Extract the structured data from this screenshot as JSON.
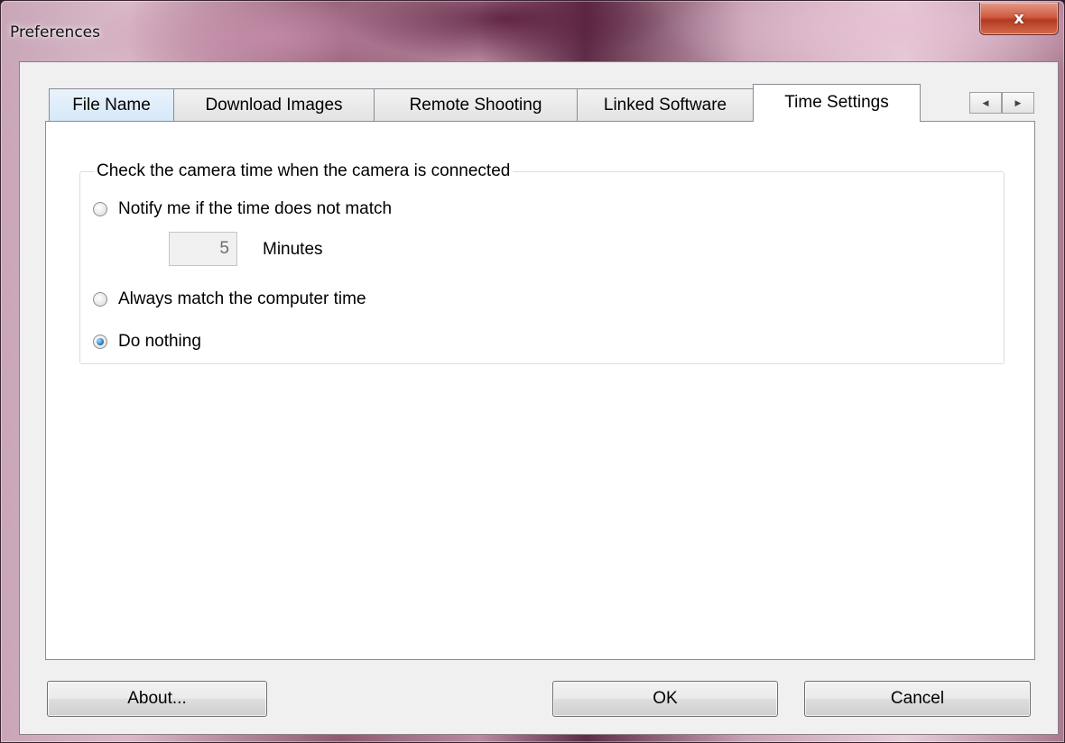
{
  "window": {
    "title": "Preferences",
    "close_glyph": "x"
  },
  "tabs": [
    {
      "label": "File Name",
      "active": false
    },
    {
      "label": "Download Images",
      "active": false
    },
    {
      "label": "Remote Shooting",
      "active": false
    },
    {
      "label": "Linked Software",
      "active": false
    },
    {
      "label": "Time Settings",
      "active": true
    }
  ],
  "tab_scroll": {
    "left_glyph": "◀",
    "right_glyph": "▶"
  },
  "time_settings": {
    "group_title": "Check the camera time when the camera is connected",
    "options": [
      {
        "label": "Notify me if the time does not match",
        "checked": false
      },
      {
        "label": "Always match the computer time",
        "checked": false
      },
      {
        "label": "Do nothing",
        "checked": true
      }
    ],
    "minutes_value": "5",
    "minutes_label": "Minutes"
  },
  "buttons": {
    "about": "About...",
    "ok": "OK",
    "cancel": "Cancel"
  },
  "colors": {
    "accent_radio": "#1a6fb5",
    "close_button": "#c7492f",
    "panel_bg": "#f0f0f0"
  }
}
